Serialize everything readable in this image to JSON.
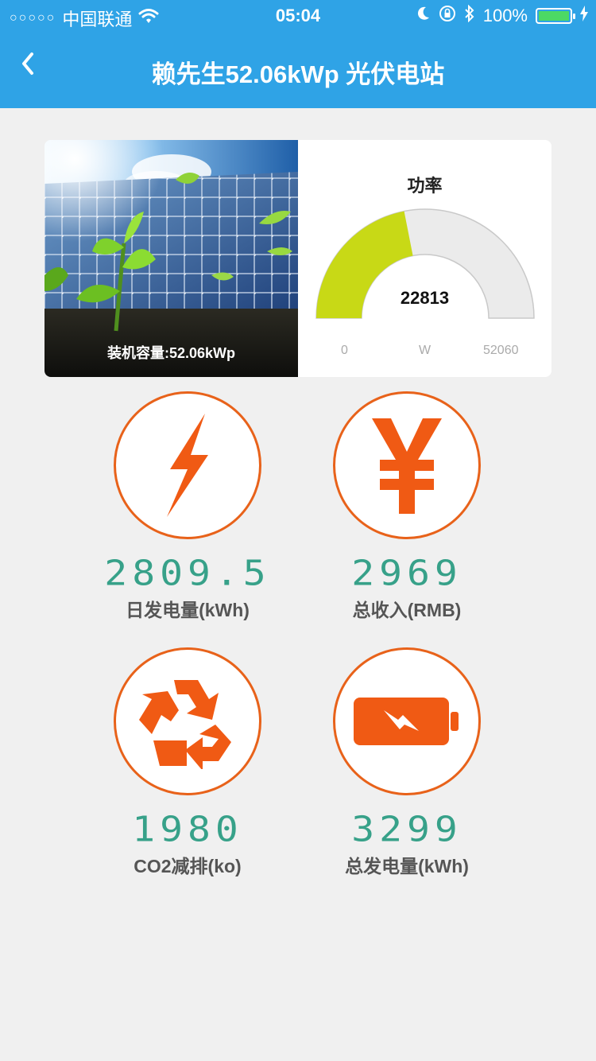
{
  "status": {
    "signal": "○○○○○",
    "carrier": "中国联通",
    "time": "05:04",
    "battery_pct": "100%"
  },
  "nav": {
    "title": "赖先生52.06kWp 光伏电站"
  },
  "plant": {
    "capacity_label": "装机容量:52.06kWp"
  },
  "gauge": {
    "title": "功率",
    "value": "22813",
    "min": "0",
    "unit": "W",
    "max": "52060",
    "fraction": 0.4382
  },
  "metrics": [
    {
      "icon": "lightning-icon",
      "value": "2809.5",
      "label": "日发电量(kWh)"
    },
    {
      "icon": "yuan-icon",
      "value": "2969",
      "label": "总收入(RMB)"
    },
    {
      "icon": "recycle-icon",
      "value": "1980",
      "label": "CO2减排(ko)"
    },
    {
      "icon": "battery-charge-icon",
      "value": "3299",
      "label": "总发电量(kWh)"
    }
  ],
  "colors": {
    "header": "#2fa3e6",
    "accent": "#e8621a",
    "value": "#37a189",
    "gauge_fill": "#c8d916",
    "gauge_track": "#ebebeb"
  }
}
